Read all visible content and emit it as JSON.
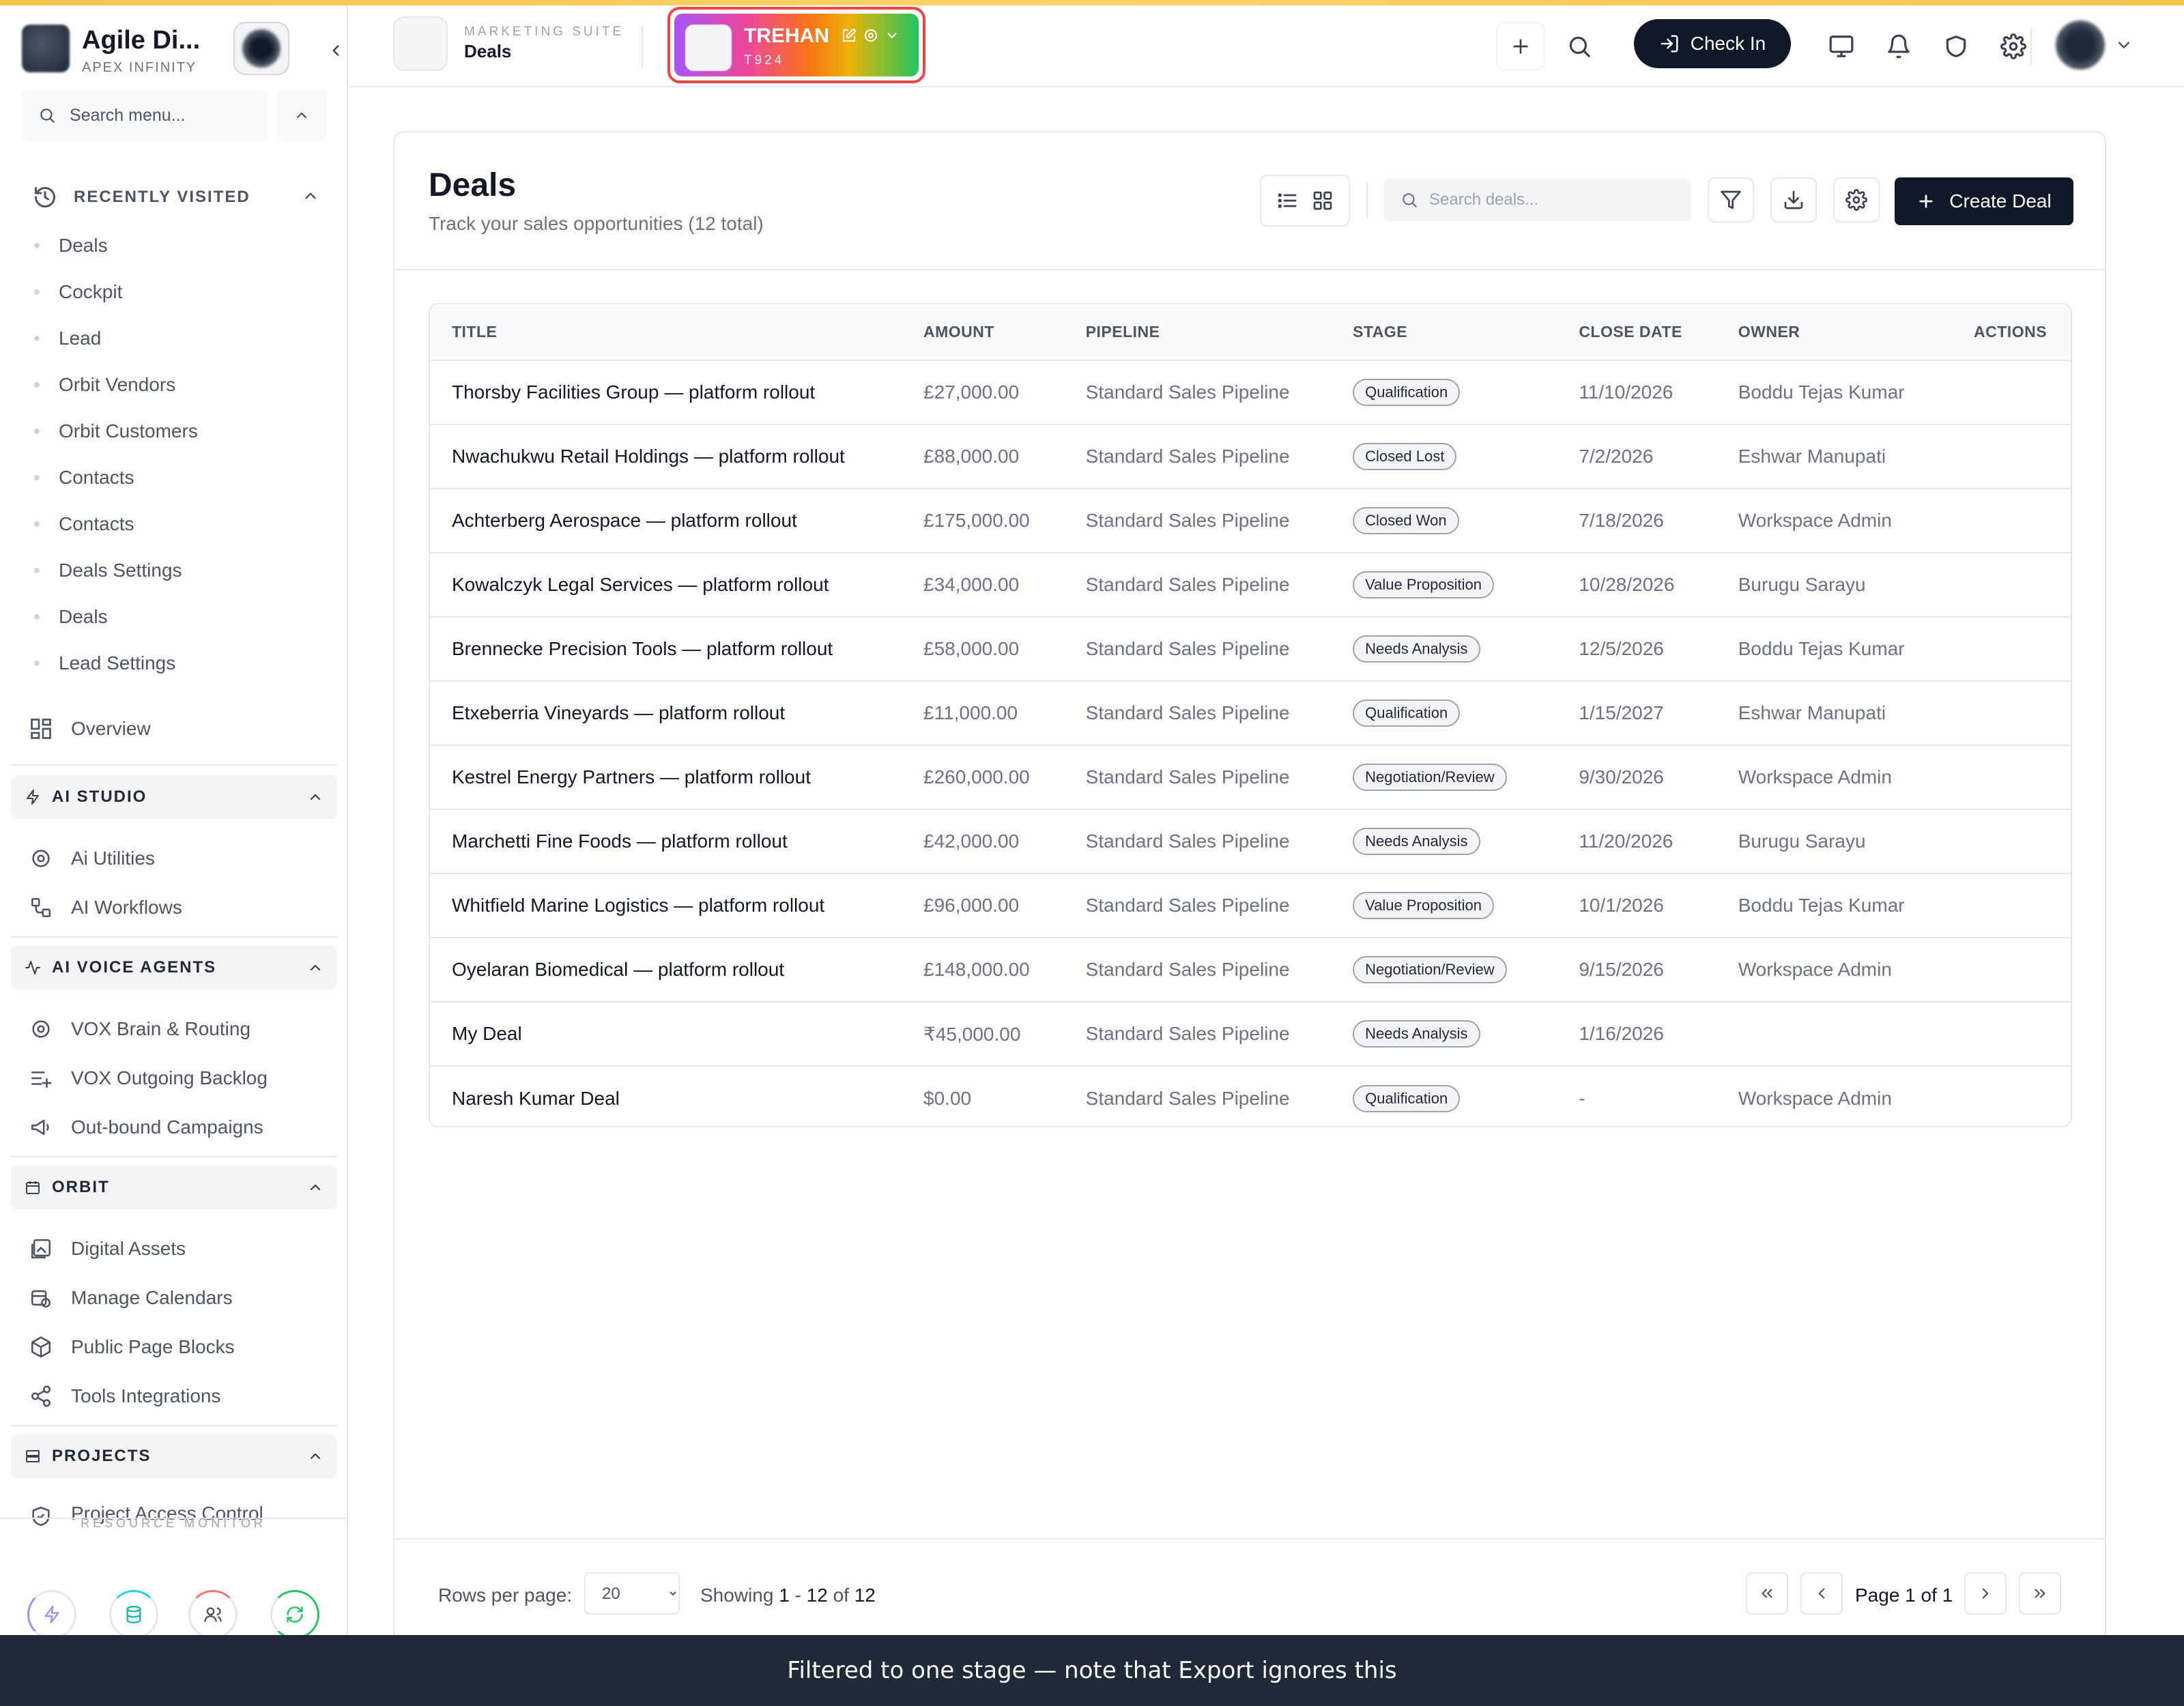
{
  "brand": {
    "name": "Agile Di...",
    "sub": "APEX INFINITY"
  },
  "search_menu": {
    "placeholder": "Search menu..."
  },
  "recent": {
    "heading": "RECENTLY VISITED",
    "items": [
      "Deals",
      "Cockpit",
      "Lead",
      "Orbit Vendors",
      "Orbit Customers",
      "Contacts",
      "Contacts",
      "Deals Settings",
      "Deals",
      "Lead Settings"
    ]
  },
  "nav": {
    "overview": "Overview",
    "ai_studio": {
      "title": "AI STUDIO",
      "items": [
        "Ai Utilities",
        "AI Workflows"
      ]
    },
    "ai_voice": {
      "title": "AI VOICE AGENTS",
      "items": [
        "VOX Brain & Routing",
        "VOX Outgoing Backlog",
        "Out-bound Campaigns"
      ]
    },
    "orbit": {
      "title": "ORBIT",
      "items": [
        "Digital Assets",
        "Manage Calendars",
        "Public Page Blocks",
        "Tools Integrations"
      ]
    },
    "projects": {
      "title": "PROJECTS",
      "items": [
        "Project Access Control"
      ]
    }
  },
  "resource_monitor": {
    "label": "RESOURCE MONITOR"
  },
  "header": {
    "suite_tag": "MARKETING SUITE",
    "suite_title": "Deals",
    "tenant_name": "TREHAN",
    "tenant_code": "T924",
    "checkin_label": "Check In"
  },
  "page": {
    "title": "Deals",
    "subtitle": "Track your sales opportunities (12 total)",
    "search_placeholder": "Search deals...",
    "create_label": "Create Deal"
  },
  "table": {
    "headers": [
      "TITLE",
      "AMOUNT",
      "PIPELINE",
      "STAGE",
      "CLOSE DATE",
      "OWNER",
      "ACTIONS"
    ],
    "rows": [
      {
        "title": "Thorsby Facilities Group — platform rollout",
        "amount": "£27,000.00",
        "pipeline": "Standard Sales Pipeline",
        "stage": "Qualification",
        "close": "11/10/2026",
        "owner": "Boddu Tejas Kumar"
      },
      {
        "title": "Nwachukwu Retail Holdings — platform rollout",
        "amount": "£88,000.00",
        "pipeline": "Standard Sales Pipeline",
        "stage": "Closed Lost",
        "close": "7/2/2026",
        "owner": "Eshwar Manupati"
      },
      {
        "title": "Achterberg Aerospace — platform rollout",
        "amount": "£175,000.00",
        "pipeline": "Standard Sales Pipeline",
        "stage": "Closed Won",
        "close": "7/18/2026",
        "owner": "Workspace Admin"
      },
      {
        "title": "Kowalczyk Legal Services — platform rollout",
        "amount": "£34,000.00",
        "pipeline": "Standard Sales Pipeline",
        "stage": "Value Proposition",
        "close": "10/28/2026",
        "owner": "Burugu Sarayu"
      },
      {
        "title": "Brennecke Precision Tools — platform rollout",
        "amount": "£58,000.00",
        "pipeline": "Standard Sales Pipeline",
        "stage": "Needs Analysis",
        "close": "12/5/2026",
        "owner": "Boddu Tejas Kumar"
      },
      {
        "title": "Etxeberria Vineyards — platform rollout",
        "amount": "£11,000.00",
        "pipeline": "Standard Sales Pipeline",
        "stage": "Qualification",
        "close": "1/15/2027",
        "owner": "Eshwar Manupati"
      },
      {
        "title": "Kestrel Energy Partners — platform rollout",
        "amount": "£260,000.00",
        "pipeline": "Standard Sales Pipeline",
        "stage": "Negotiation/Review",
        "close": "9/30/2026",
        "owner": "Workspace Admin"
      },
      {
        "title": "Marchetti Fine Foods — platform rollout",
        "amount": "£42,000.00",
        "pipeline": "Standard Sales Pipeline",
        "stage": "Needs Analysis",
        "close": "11/20/2026",
        "owner": "Burugu Sarayu"
      },
      {
        "title": "Whitfield Marine Logistics — platform rollout",
        "amount": "£96,000.00",
        "pipeline": "Standard Sales Pipeline",
        "stage": "Value Proposition",
        "close": "10/1/2026",
        "owner": "Boddu Tejas Kumar"
      },
      {
        "title": "Oyelaran Biomedical — platform rollout",
        "amount": "£148,000.00",
        "pipeline": "Standard Sales Pipeline",
        "stage": "Negotiation/Review",
        "close": "9/15/2026",
        "owner": "Workspace Admin"
      },
      {
        "title": "My Deal",
        "amount": "₹45,000.00",
        "pipeline": "Standard Sales Pipeline",
        "stage": "Needs Analysis",
        "close": "1/16/2026",
        "owner": ""
      },
      {
        "title": "Naresh Kumar Deal",
        "amount": "$0.00",
        "pipeline": "Standard Sales Pipeline",
        "stage": "Qualification",
        "close": "-",
        "owner": "Workspace Admin"
      }
    ]
  },
  "pagination": {
    "rows_label": "Rows per page:",
    "rows_value": "20",
    "showing_prefix": "Showing",
    "range_start": "1",
    "range_sep": "-",
    "range_end": "12",
    "of_word": "of",
    "total": "12",
    "page_text": "Page 1 of 1"
  },
  "toast": {
    "message": "Filtered to one stage — note that Export ignores this"
  },
  "colors": {
    "primary": "#111827",
    "highlight_border": "#ef4444",
    "top_stripe": "#f6c34a"
  }
}
